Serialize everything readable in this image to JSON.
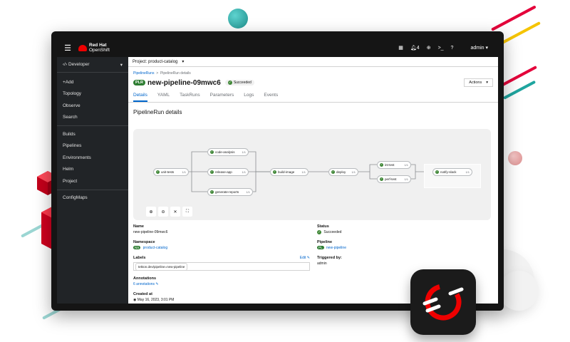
{
  "masthead": {
    "brand_line1": "Red Hat",
    "brand_line2": "OpenShift",
    "notifications_count": "4",
    "user_menu": "admin"
  },
  "sidebar": {
    "perspective": "Developer",
    "items": [
      "+Add",
      "Topology",
      "Observe",
      "Search",
      "Builds",
      "Pipelines",
      "Environments",
      "Helm",
      "Project",
      "ConfigMaps"
    ]
  },
  "project_bar": {
    "label": "Project: product-catalog"
  },
  "breadcrumb": {
    "parent": "PipelineRuns",
    "current": "PipelineRun details"
  },
  "header": {
    "badge": "PLR",
    "title": "new-pipeline-09mwc6",
    "status": "Succeeded",
    "actions_label": "Actions"
  },
  "tabs": [
    "Details",
    "YAML",
    "TaskRuns",
    "Parameters",
    "Logs",
    "Events"
  ],
  "section_title": "PipelineRun details",
  "pipeline": {
    "tasks": [
      {
        "name": "unit-tests",
        "count": "1/1"
      },
      {
        "name": "code-analysis",
        "count": "1/1"
      },
      {
        "name": "release-app",
        "count": "1/1"
      },
      {
        "name": "generate-reports",
        "count": "1/1"
      },
      {
        "name": "build-image",
        "count": "1/1"
      },
      {
        "name": "deploy",
        "count": "1/1"
      },
      {
        "name": "int-test",
        "count": "1/1"
      },
      {
        "name": "perf-test",
        "count": "1/1"
      },
      {
        "name": "notify-slack",
        "count": "1/1"
      }
    ]
  },
  "details": {
    "name_label": "Name",
    "name_value": "new-pipeline-09mwc6",
    "namespace_label": "Namespace",
    "namespace_badge": "NS",
    "namespace_value": "product-catalog",
    "labels_label": "Labels",
    "labels_edit": "Edit",
    "label_chip": "tekton.dev/pipeline=new-pipeline",
    "annotations_label": "Annotations",
    "annotations_value": "6 annotations",
    "created_label": "Created at",
    "created_value": "May 16, 2023, 3:01 PM",
    "status_label": "Status",
    "status_value": "Succeeded",
    "pipeline_label": "Pipeline",
    "pipeline_badge": "PL",
    "pipeline_value": "new-pipeline",
    "triggered_label": "Triggered by:",
    "triggered_value": "admin"
  },
  "colors": {
    "accent": "#0066cc",
    "success": "#3e8635",
    "brand": "#ee0000",
    "masthead": "#151515",
    "sidebar": "#212427"
  }
}
